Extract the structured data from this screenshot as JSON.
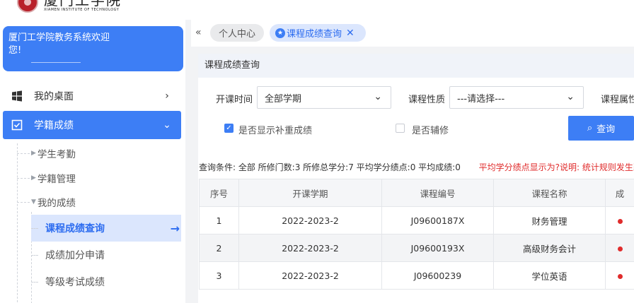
{
  "logo": {
    "name_cn": "厦门工学院",
    "name_en": "XIAMEN INSTITUTE OF TECHNOLOGY"
  },
  "sidebar": {
    "welcome": "厦门工学院教务系统欢迎您!",
    "menu": [
      {
        "label": "我的桌面"
      },
      {
        "label": "学籍成绩"
      }
    ],
    "sub_items": [
      {
        "label": "学生考勤"
      },
      {
        "label": "学籍管理"
      },
      {
        "label": "我的成绩"
      }
    ],
    "leaf_items": [
      {
        "label": "课程成绩查询"
      },
      {
        "label": "成绩加分申请"
      },
      {
        "label": "等级考试成绩"
      }
    ]
  },
  "tabs": [
    {
      "label": "个人中心"
    },
    {
      "label": "课程成绩查询"
    }
  ],
  "panel": {
    "title": "课程成绩查询",
    "filters": {
      "term_label": "开课时间",
      "term_value": "全部学期",
      "nature_label": "课程性质",
      "nature_value": "---请选择---",
      "attr_label": "课程属性"
    },
    "checkboxes": {
      "show_retake": "是否显示补重成绩",
      "show_retake_checked": true,
      "minor": "是否辅修",
      "minor_checked": false
    },
    "query_button": "查询",
    "conditions": "查询条件: 全部 所修门数:3 所修总学分:7 平均学分绩点:0 平均成绩:0",
    "warning": "平均学分绩点显示为?说明: 统计规则发生改"
  },
  "table": {
    "headers": [
      "序号",
      "开课学期",
      "课程编号",
      "课程名称",
      "成"
    ],
    "rows": [
      [
        "1",
        "2022-2023-2",
        "J09600187X",
        "财务管理"
      ],
      [
        "2",
        "2022-2023-2",
        "J09600193X",
        "高级财务会计"
      ],
      [
        "3",
        "2022-2023-2",
        "J09600239",
        "学位英语"
      ]
    ]
  },
  "colors": {
    "accent": "#3d7ef5",
    "warning": "#e02c2c",
    "active_bg": "#dbe6fd"
  }
}
